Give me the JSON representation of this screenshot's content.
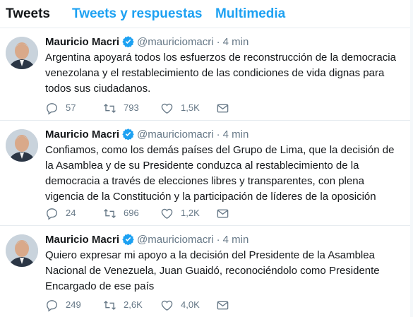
{
  "tabs": [
    {
      "label": "Tweets",
      "active": true
    },
    {
      "label": "Tweets y respuestas",
      "active": false
    },
    {
      "label": "Multimedia",
      "active": false
    }
  ],
  "colors": {
    "accent": "#1da1f2",
    "text_primary": "#14171a",
    "text_secondary": "#657786",
    "divider": "#e6ecf0"
  },
  "icons": {
    "verified": "verified-badge-icon",
    "reply": "reply-icon",
    "retweet": "retweet-icon",
    "like": "heart-icon",
    "message": "envelope-icon"
  },
  "tweets": [
    {
      "author": "Mauricio Macri",
      "handle": "@mauriciomacri",
      "separator": "·",
      "time": "4 min",
      "text": "Argentina apoyará todos los esfuerzos de reconstrucción de la democracia venezolana y el restablecimiento de las condiciones de vida dignas para todos sus ciudadanos.",
      "replies": "57",
      "retweets": "793",
      "likes": "1,5K"
    },
    {
      "author": "Mauricio Macri",
      "handle": "@mauriciomacri",
      "separator": "·",
      "time": "4 min",
      "text": "Confiamos, como los demás países del Grupo de Lima, que la decisión de la Asamblea y de su Presidente conduzca al restablecimiento de la democracia a través de elecciones libres y transparentes, con plena vigencia de la Constitución y la participación de líderes de la oposición",
      "replies": "24",
      "retweets": "696",
      "likes": "1,2K"
    },
    {
      "author": "Mauricio Macri",
      "handle": "@mauriciomacri",
      "separator": "·",
      "time": "4 min",
      "text": "Quiero expresar mi apoyo a la decisión del Presidente de la Asamblea Nacional de Venezuela, Juan Guaidó, reconociéndolo como Presidente Encargado de ese país",
      "replies": "249",
      "retweets": "2,6K",
      "likes": "4,0K"
    }
  ]
}
